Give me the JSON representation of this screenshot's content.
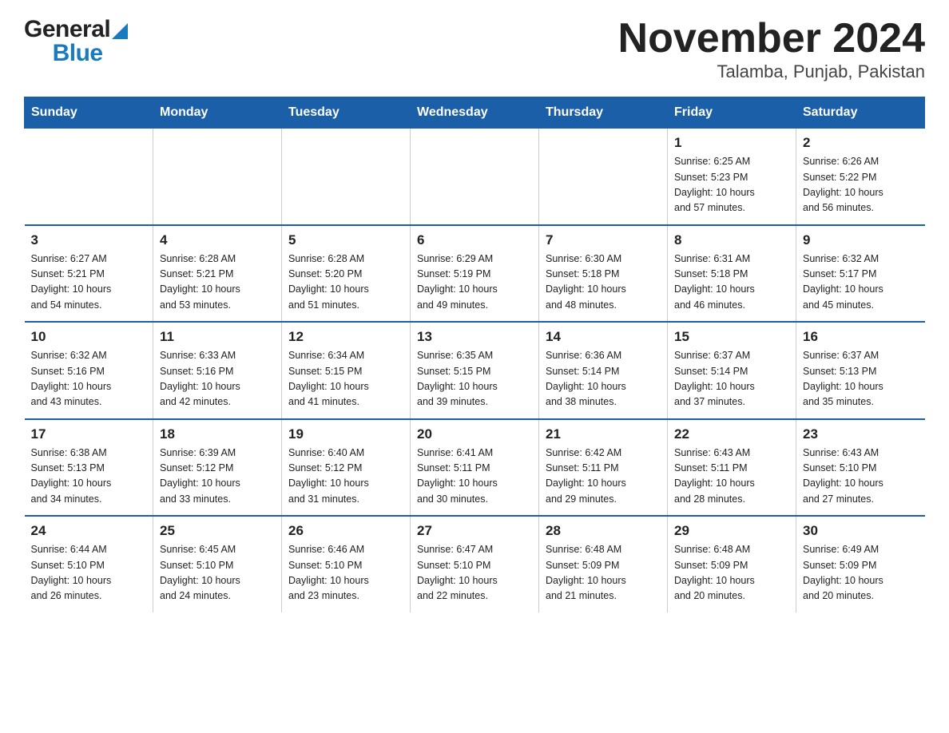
{
  "logo": {
    "general": "General",
    "blue": "Blue"
  },
  "title": "November 2024",
  "subtitle": "Talamba, Punjab, Pakistan",
  "weekdays": [
    "Sunday",
    "Monday",
    "Tuesday",
    "Wednesday",
    "Thursday",
    "Friday",
    "Saturday"
  ],
  "weeks": [
    [
      {
        "day": "",
        "info": ""
      },
      {
        "day": "",
        "info": ""
      },
      {
        "day": "",
        "info": ""
      },
      {
        "day": "",
        "info": ""
      },
      {
        "day": "",
        "info": ""
      },
      {
        "day": "1",
        "info": "Sunrise: 6:25 AM\nSunset: 5:23 PM\nDaylight: 10 hours\nand 57 minutes."
      },
      {
        "day": "2",
        "info": "Sunrise: 6:26 AM\nSunset: 5:22 PM\nDaylight: 10 hours\nand 56 minutes."
      }
    ],
    [
      {
        "day": "3",
        "info": "Sunrise: 6:27 AM\nSunset: 5:21 PM\nDaylight: 10 hours\nand 54 minutes."
      },
      {
        "day": "4",
        "info": "Sunrise: 6:28 AM\nSunset: 5:21 PM\nDaylight: 10 hours\nand 53 minutes."
      },
      {
        "day": "5",
        "info": "Sunrise: 6:28 AM\nSunset: 5:20 PM\nDaylight: 10 hours\nand 51 minutes."
      },
      {
        "day": "6",
        "info": "Sunrise: 6:29 AM\nSunset: 5:19 PM\nDaylight: 10 hours\nand 49 minutes."
      },
      {
        "day": "7",
        "info": "Sunrise: 6:30 AM\nSunset: 5:18 PM\nDaylight: 10 hours\nand 48 minutes."
      },
      {
        "day": "8",
        "info": "Sunrise: 6:31 AM\nSunset: 5:18 PM\nDaylight: 10 hours\nand 46 minutes."
      },
      {
        "day": "9",
        "info": "Sunrise: 6:32 AM\nSunset: 5:17 PM\nDaylight: 10 hours\nand 45 minutes."
      }
    ],
    [
      {
        "day": "10",
        "info": "Sunrise: 6:32 AM\nSunset: 5:16 PM\nDaylight: 10 hours\nand 43 minutes."
      },
      {
        "day": "11",
        "info": "Sunrise: 6:33 AM\nSunset: 5:16 PM\nDaylight: 10 hours\nand 42 minutes."
      },
      {
        "day": "12",
        "info": "Sunrise: 6:34 AM\nSunset: 5:15 PM\nDaylight: 10 hours\nand 41 minutes."
      },
      {
        "day": "13",
        "info": "Sunrise: 6:35 AM\nSunset: 5:15 PM\nDaylight: 10 hours\nand 39 minutes."
      },
      {
        "day": "14",
        "info": "Sunrise: 6:36 AM\nSunset: 5:14 PM\nDaylight: 10 hours\nand 38 minutes."
      },
      {
        "day": "15",
        "info": "Sunrise: 6:37 AM\nSunset: 5:14 PM\nDaylight: 10 hours\nand 37 minutes."
      },
      {
        "day": "16",
        "info": "Sunrise: 6:37 AM\nSunset: 5:13 PM\nDaylight: 10 hours\nand 35 minutes."
      }
    ],
    [
      {
        "day": "17",
        "info": "Sunrise: 6:38 AM\nSunset: 5:13 PM\nDaylight: 10 hours\nand 34 minutes."
      },
      {
        "day": "18",
        "info": "Sunrise: 6:39 AM\nSunset: 5:12 PM\nDaylight: 10 hours\nand 33 minutes."
      },
      {
        "day": "19",
        "info": "Sunrise: 6:40 AM\nSunset: 5:12 PM\nDaylight: 10 hours\nand 31 minutes."
      },
      {
        "day": "20",
        "info": "Sunrise: 6:41 AM\nSunset: 5:11 PM\nDaylight: 10 hours\nand 30 minutes."
      },
      {
        "day": "21",
        "info": "Sunrise: 6:42 AM\nSunset: 5:11 PM\nDaylight: 10 hours\nand 29 minutes."
      },
      {
        "day": "22",
        "info": "Sunrise: 6:43 AM\nSunset: 5:11 PM\nDaylight: 10 hours\nand 28 minutes."
      },
      {
        "day": "23",
        "info": "Sunrise: 6:43 AM\nSunset: 5:10 PM\nDaylight: 10 hours\nand 27 minutes."
      }
    ],
    [
      {
        "day": "24",
        "info": "Sunrise: 6:44 AM\nSunset: 5:10 PM\nDaylight: 10 hours\nand 26 minutes."
      },
      {
        "day": "25",
        "info": "Sunrise: 6:45 AM\nSunset: 5:10 PM\nDaylight: 10 hours\nand 24 minutes."
      },
      {
        "day": "26",
        "info": "Sunrise: 6:46 AM\nSunset: 5:10 PM\nDaylight: 10 hours\nand 23 minutes."
      },
      {
        "day": "27",
        "info": "Sunrise: 6:47 AM\nSunset: 5:10 PM\nDaylight: 10 hours\nand 22 minutes."
      },
      {
        "day": "28",
        "info": "Sunrise: 6:48 AM\nSunset: 5:09 PM\nDaylight: 10 hours\nand 21 minutes."
      },
      {
        "day": "29",
        "info": "Sunrise: 6:48 AM\nSunset: 5:09 PM\nDaylight: 10 hours\nand 20 minutes."
      },
      {
        "day": "30",
        "info": "Sunrise: 6:49 AM\nSunset: 5:09 PM\nDaylight: 10 hours\nand 20 minutes."
      }
    ]
  ]
}
